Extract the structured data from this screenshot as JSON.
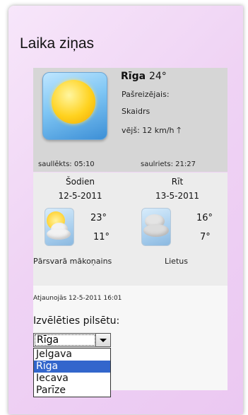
{
  "title": "Laika ziņas",
  "current": {
    "city": "Rīga",
    "temp": "24°",
    "label": "Pašreizējais:",
    "condition": "Skaidrs",
    "wind": "vējš: 12 km/h",
    "wind_arrow": "🡑",
    "sunrise": "saullēkts: 05:10",
    "sunset": "saulriets: 21:27"
  },
  "forecast": [
    {
      "day": "Šodien",
      "date": "12-5-2011",
      "high": "23°",
      "low": "11°",
      "desc": "Pārsvarā mākoņains"
    },
    {
      "day": "Rīt",
      "date": "13-5-2011",
      "high": "16°",
      "low": "7°",
      "desc": "Lietus"
    }
  ],
  "updated": "Atjaunojās 12-5-2011 16:01",
  "city_select": {
    "label": "Izvēlēties pilsētu:",
    "value": "Rīga",
    "options": [
      "Jelgava",
      "Rīga",
      "Iecava",
      "Parīze"
    ],
    "highlighted": "Rīga"
  },
  "colors": {
    "gadget_bg": "#efd3f4",
    "highlight": "#3366cc"
  }
}
